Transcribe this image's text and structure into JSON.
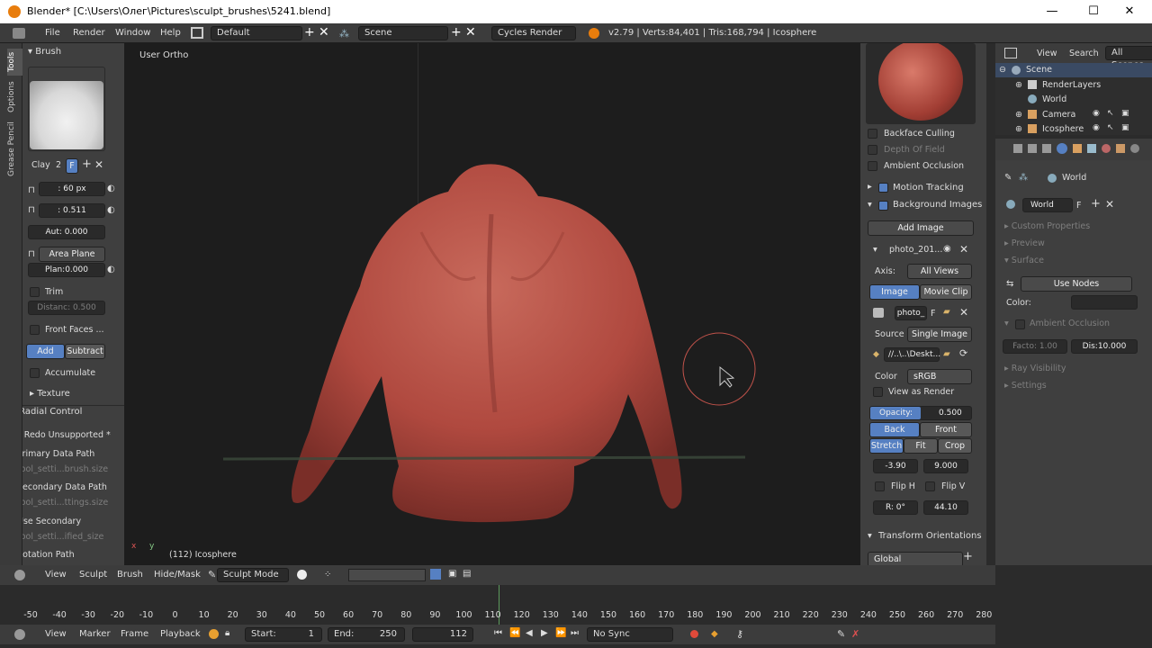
{
  "window": {
    "title": "Blender* [C:\\Users\\Олег\\Pictures\\sculpt_brushes\\5241.blend]",
    "minimize": "—",
    "maximize": "☐",
    "close": "✕"
  },
  "topbar": {
    "menus": [
      "File",
      "Render",
      "Window",
      "Help"
    ],
    "layout": "Default",
    "scene": "Scene",
    "engine": "Cycles Render",
    "stats": "v2.79 | Verts:84,401 | Tris:168,794 | Icosphere"
  },
  "tabs": {
    "tools": "Tools",
    "options": "Options",
    "grease": "Grease Pencil"
  },
  "brush": {
    "header": "Brush",
    "name": "Clay",
    "users": "2",
    "fake": "F",
    "radius": ": 60 px",
    "strength": ": 0.511",
    "autosmooth": "Aut: 0.000",
    "plane": "Area Plane",
    "plane_offset": "Plan:0.000",
    "trim": "Trim",
    "distance": "Distanc: 0.500",
    "front_faces": "Front Faces ...",
    "add": "Add",
    "subtract": "Subtract",
    "accumulate": "Accumulate",
    "texture": "Texture"
  },
  "radial": {
    "header": "Radial Control",
    "redo": "* Redo Unsupported *",
    "primary_label": "Primary Data Path",
    "primary_value": "tool_setti...brush.size",
    "secondary_label": "Secondary Data Path",
    "secondary_value": "tool_setti...ttings.size",
    "use_secondary_label": "Use Secondary",
    "use_secondary_value": "tool_setti...ified_size",
    "rotation": "Rotation Path"
  },
  "viewport": {
    "view_label": "User Ortho",
    "object_label": "(112) Icosphere",
    "axis_x": "x",
    "axis_y": "y"
  },
  "npanel": {
    "backface": "Backface Culling",
    "depth": "Depth Of Field",
    "ao": "Ambient Occlusion",
    "motion": "Motion Tracking",
    "bgimages": "Background Images",
    "add_image": "Add Image",
    "photo_name": "photo_201...",
    "axis_label": "Axis:",
    "axis_value": "All Views",
    "image_tab": "Image",
    "movie_tab": "Movie Clip",
    "photo_field": "photo_",
    "photo_f": "F",
    "source_label": "Source",
    "source_value": "Single Image",
    "path": "//..\\..\\Deskt...",
    "color_label": "Color",
    "color_value": "sRGB",
    "view_render": "View as Render",
    "opacity_label": "Opacity:",
    "opacity_value": "0.500",
    "opacity": 0.5,
    "back": "Back",
    "front": "Front",
    "stretch": "Stretch",
    "fit": "Fit",
    "crop": "Crop",
    "offset_x": "-3.90",
    "offset_y": "9.000",
    "flip_h": "Flip H",
    "flip_v": "Flip V",
    "rotation": "R: 0°",
    "size": "44.10",
    "transform": "Transform Orientations",
    "global": "Global"
  },
  "outliner": {
    "view": "View",
    "search": "Search",
    "all_scenes": "All Scenes",
    "items": [
      "Scene",
      "RenderLayers",
      "World",
      "Camera",
      "Icosphere"
    ]
  },
  "properties": {
    "world_path": "World",
    "world_field": "World",
    "world_f": "F",
    "custom_props": "Custom Properties",
    "preview": "Preview",
    "surface": "Surface",
    "use_nodes": "Use Nodes",
    "color_label": "Color:",
    "ao": "Ambient Occlusion",
    "factor": "Facto: 1.00",
    "distance": "Dis:10.000",
    "ray_visibility": "Ray Visibility",
    "settings": "Settings"
  },
  "viewheader": {
    "menus": [
      "View",
      "Sculpt",
      "Brush",
      "Hide/Mask"
    ],
    "mode": "Sculpt Mode"
  },
  "timeline": {
    "ticks": [
      "-50",
      "-40",
      "-30",
      "-20",
      "-10",
      "0",
      "10",
      "20",
      "30",
      "40",
      "50",
      "60",
      "70",
      "80",
      "90",
      "100",
      "110",
      "120",
      "130",
      "140",
      "150",
      "160",
      "170",
      "180",
      "190",
      "200",
      "210",
      "220",
      "230",
      "240",
      "250",
      "260",
      "270",
      "280"
    ],
    "current_frame": 112
  },
  "timeheader": {
    "menus": [
      "View",
      "Marker",
      "Frame",
      "Playback"
    ],
    "start_label": "Start:",
    "start_value": "1",
    "end_label": "End:",
    "end_value": "250",
    "current": "112",
    "sync": "No Sync"
  },
  "colors": {
    "accent": "#5680c2",
    "model": "#b8544a",
    "cursor_ring": "#c0524a"
  }
}
